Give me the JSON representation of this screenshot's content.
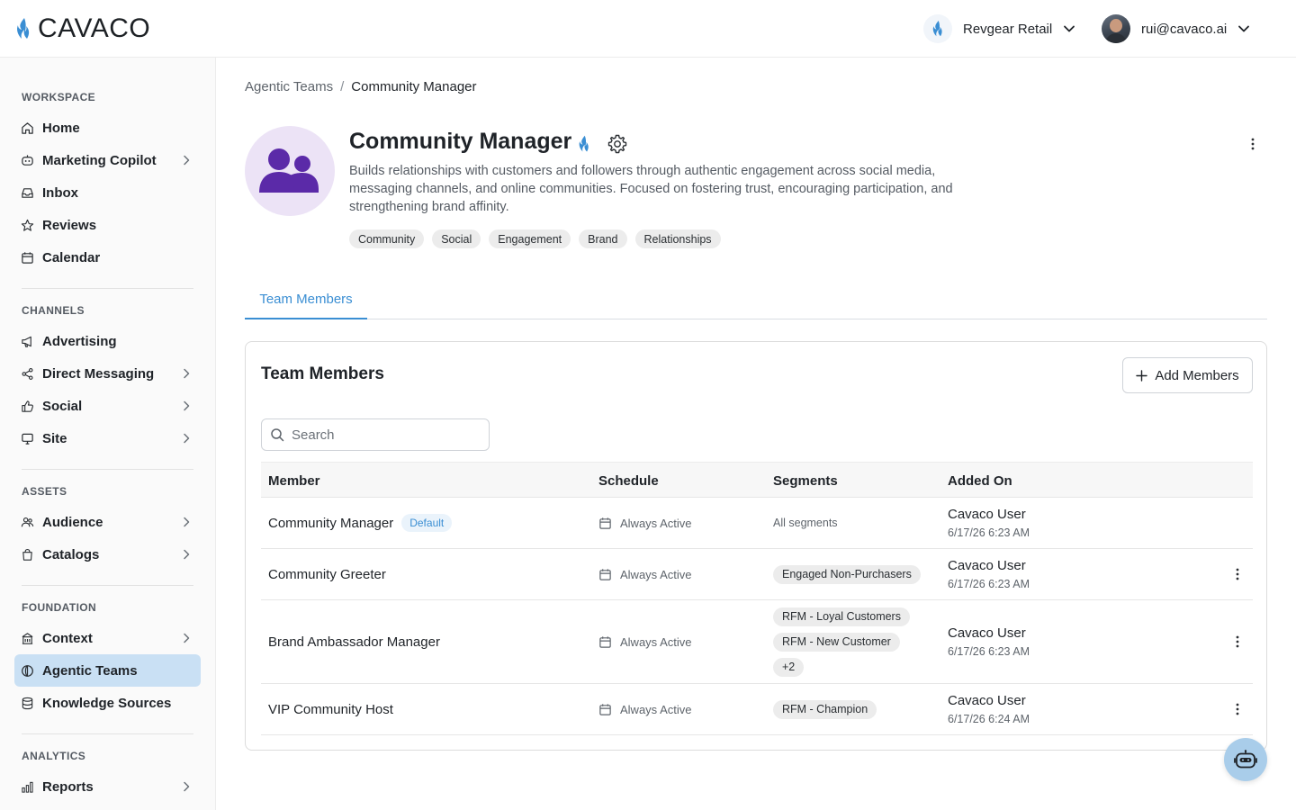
{
  "header": {
    "logo_text": "CAVACO",
    "org_name": "Revgear Retail",
    "user_email": "rui@cavaco.ai"
  },
  "sidebar": {
    "sections": {
      "workspace": "WORKSPACE",
      "channels": "CHANNELS",
      "assets": "ASSETS",
      "foundation": "FOUNDATION",
      "analytics": "ANALYTICS"
    },
    "items": {
      "home": "Home",
      "marketing_copilot": "Marketing Copilot",
      "inbox": "Inbox",
      "reviews": "Reviews",
      "calendar": "Calendar",
      "advertising": "Advertising",
      "direct_messaging": "Direct Messaging",
      "social": "Social",
      "site": "Site",
      "audience": "Audience",
      "catalogs": "Catalogs",
      "context": "Context",
      "agentic_teams": "Agentic Teams",
      "knowledge_sources": "Knowledge Sources",
      "reports": "Reports"
    },
    "active_item": "agentic_teams"
  },
  "breadcrumb": {
    "parent": "Agentic Teams",
    "separator": "/",
    "current": "Community Manager"
  },
  "team": {
    "name": "Community Manager",
    "description": "Builds relationships with customers and followers through authentic engagement across social media, messaging channels, and online communities. Focused on fostering trust, encouraging participation, and strengthening brand affinity.",
    "tags": [
      "Community",
      "Social",
      "Engagement",
      "Brand",
      "Relationships"
    ]
  },
  "tabs": {
    "team_members": "Team Members"
  },
  "members_card": {
    "title": "Team Members",
    "add_button": "Add Members",
    "search_placeholder": "Search",
    "columns": {
      "member": "Member",
      "schedule": "Schedule",
      "segments": "Segments",
      "added_on": "Added On"
    },
    "rows": [
      {
        "member": "Community Manager",
        "badge": "Default",
        "schedule": "Always Active",
        "segments_text": "All segments",
        "added_by": "Cavaco User",
        "added_date": "6/17/26 6:23 AM"
      },
      {
        "member": "Community Greeter",
        "schedule": "Always Active",
        "segments": [
          "Engaged Non-Purchasers"
        ],
        "added_by": "Cavaco User",
        "added_date": "6/17/26 6:23 AM"
      },
      {
        "member": "Brand Ambassador Manager",
        "schedule": "Always Active",
        "segments": [
          "RFM - Loyal Customers",
          "RFM - New Customer",
          "+2"
        ],
        "added_by": "Cavaco User",
        "added_date": "6/17/26 6:23 AM"
      },
      {
        "member": "VIP Community Host",
        "schedule": "Always Active",
        "segments": [
          "RFM - Champion"
        ],
        "added_by": "Cavaco User",
        "added_date": "6/17/26 6:24 AM"
      }
    ]
  },
  "colors": {
    "accent": "#3a8ed3",
    "active_nav_bg": "#c9e0f4",
    "team_avatar_bg": "#ece3f6",
    "team_avatar_fg": "#5b2aa8"
  },
  "icons": {
    "logo": "flame-icon",
    "assistant": "robot-icon"
  }
}
